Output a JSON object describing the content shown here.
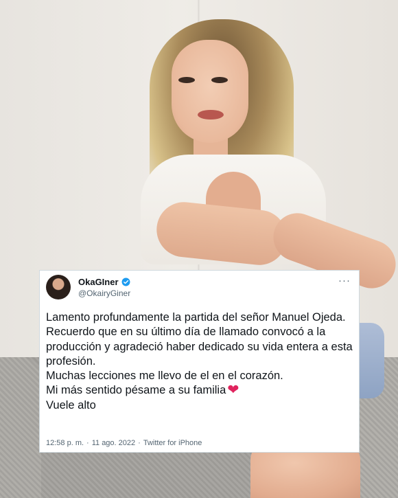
{
  "tweet": {
    "display_name": "OkaGIner",
    "handle": "@OkairyGiner",
    "more_label": "···",
    "lines": [
      "Lamento profundamente la partida del señor Manuel Ojeda.",
      "Recuerdo que en su último día de llamado convocó a la producción y agradeció haber dedicado su vida entera a esta profesión.",
      "Muchas lecciones me llevo de el en el corazón.",
      "Mi más sentido pésame a su familia",
      "Vuele alto"
    ],
    "heart_emoji": "❤",
    "time": "12:58 p. m.",
    "sep1": "·",
    "date": "11 ago. 2022",
    "sep2": "·",
    "source": "Twitter for iPhone"
  },
  "icons": {
    "verified": "verified-badge-icon",
    "more": "more-options-icon",
    "heart": "heart-emoji"
  },
  "colors": {
    "verified": "#1d9bf0",
    "heart": "#e0245e",
    "secondary_text": "#536471"
  }
}
